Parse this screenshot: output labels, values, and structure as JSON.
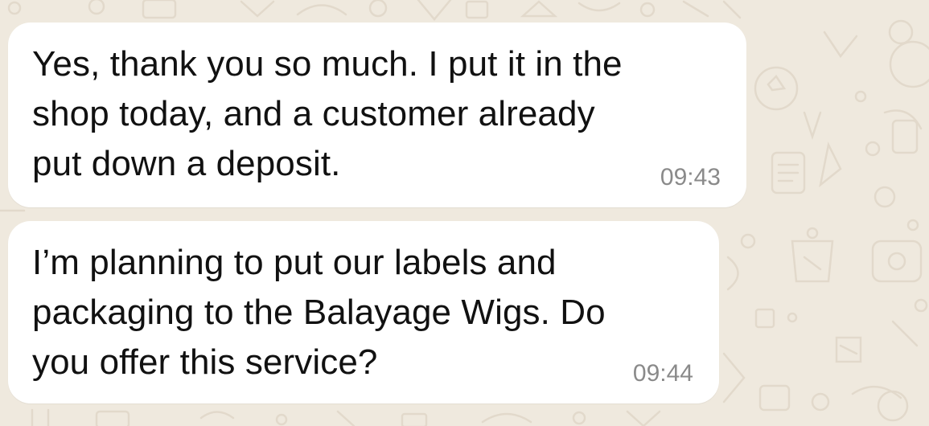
{
  "chat": {
    "messages": [
      {
        "text": "Yes, thank you so much. I put it in the\nshop today, and a customer already\nput down a deposit.",
        "time": "09:43"
      },
      {
        "text": "I’m planning to put our labels and\npackaging to the Balayage Wigs. Do\nyou offer this service?",
        "time": "09:44"
      }
    ]
  },
  "theme": {
    "wallpaper_color": "#efe9de",
    "bubble_color": "#ffffff",
    "time_color": "#8a8a8a",
    "wallpaper_style": "doodle-pattern"
  }
}
